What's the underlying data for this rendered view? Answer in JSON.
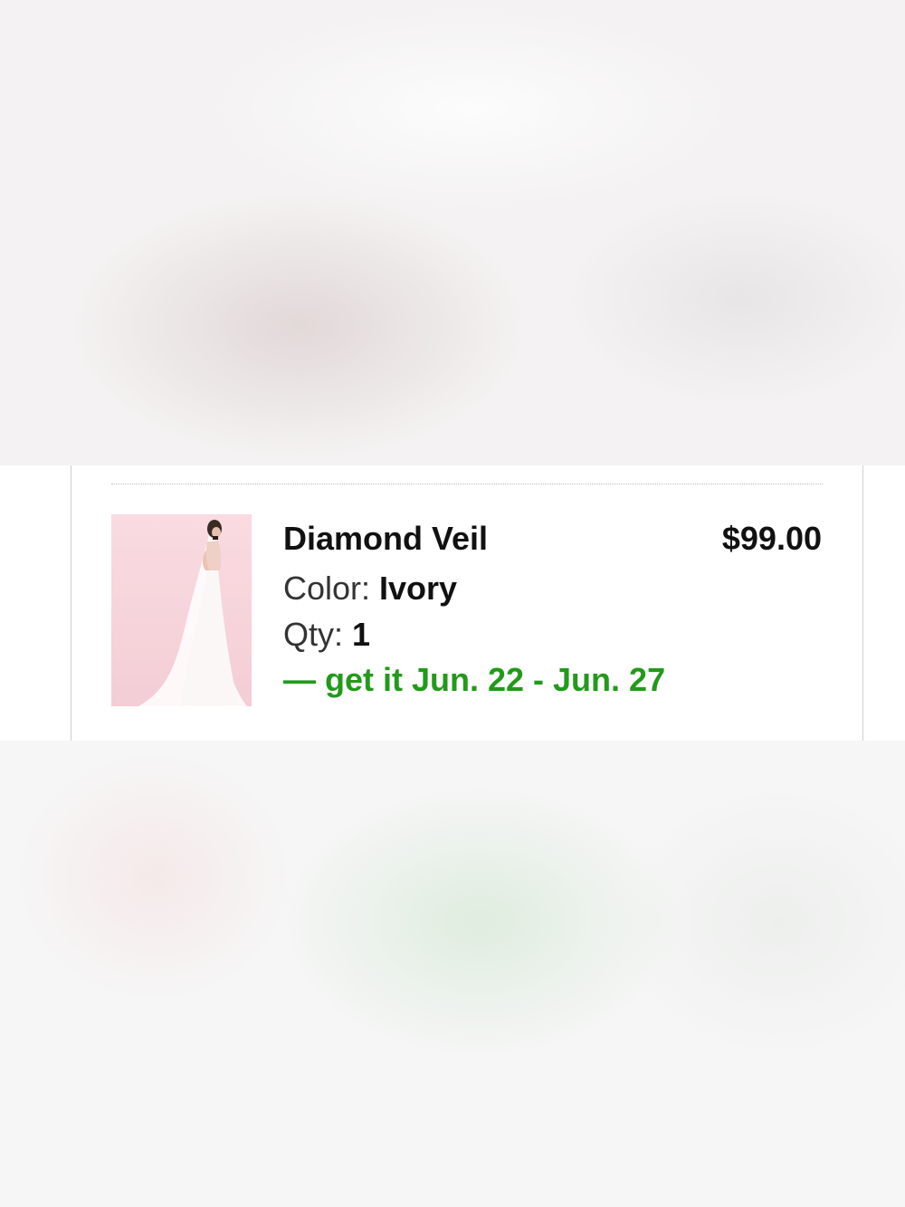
{
  "item": {
    "name": "Diamond Veil",
    "price": "$99.00",
    "color_label": "Color: ",
    "color_value": "Ivory",
    "qty_label": "Qty: ",
    "qty_value": "1",
    "delivery": "— get it Jun. 22 - Jun. 27",
    "image": "bride-in-veil-photo"
  },
  "colors": {
    "delivery": "#229a1a",
    "thumb_bg": "#f7d6dd"
  }
}
